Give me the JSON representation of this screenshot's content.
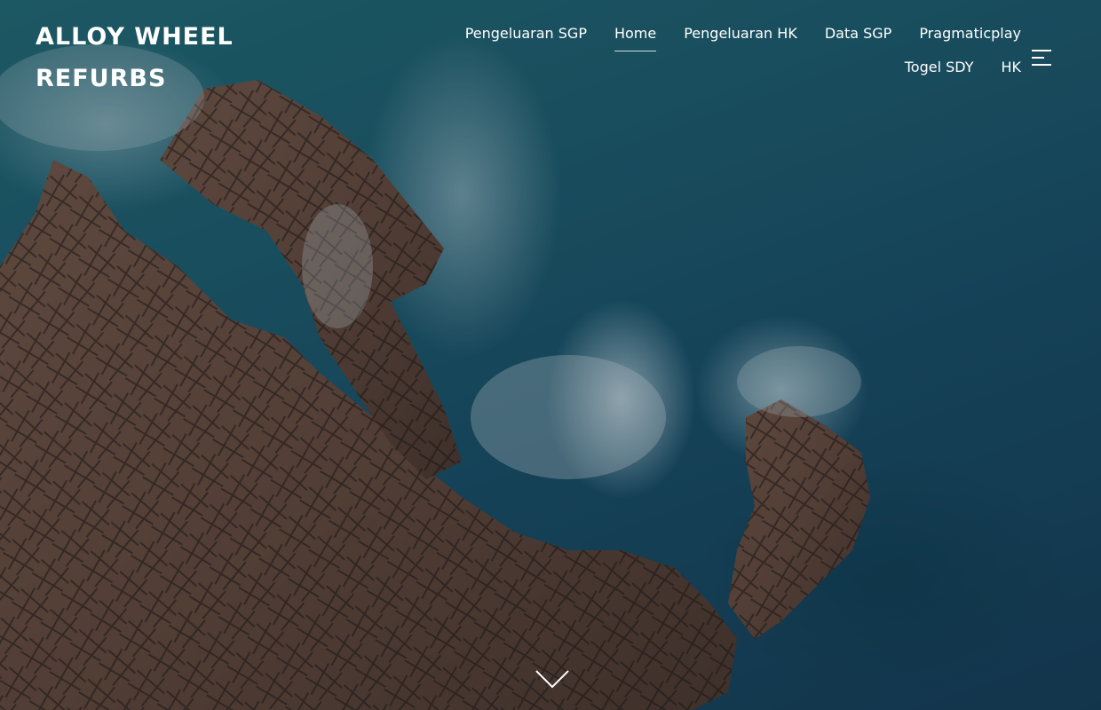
{
  "site": {
    "title": "ALLOY WHEEL REFURBS"
  },
  "nav": {
    "items": [
      {
        "label": "Pengeluaran SGP"
      },
      {
        "label": "Home",
        "active": true
      },
      {
        "label": "Pengeluaran HK"
      },
      {
        "label": "Data SGP"
      },
      {
        "label": "Pragmaticplay"
      },
      {
        "label": "Togel SDY"
      },
      {
        "label": "HK"
      }
    ]
  },
  "icons": {
    "menu_toggle": "sidebar-menu-icon",
    "scroll_down": "chevron-down-icon"
  },
  "colors": {
    "text": "#ffffff",
    "sea": "#1a5f72",
    "rock": "#6b4a3a"
  }
}
